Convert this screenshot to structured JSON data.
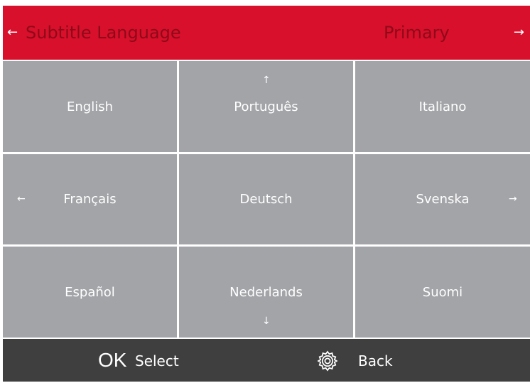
{
  "header": {
    "title": "Subtitle Language",
    "mode": "Primary",
    "left_arrow": "←",
    "right_arrow": "→"
  },
  "grid": {
    "items": [
      {
        "label": "English"
      },
      {
        "label": "Português"
      },
      {
        "label": "Italiano"
      },
      {
        "label": "Français"
      },
      {
        "label": "Deutsch"
      },
      {
        "label": "Svenska"
      },
      {
        "label": "Español"
      },
      {
        "label": "Nederlands"
      },
      {
        "label": "Suomi"
      }
    ],
    "nav": {
      "up": "↑",
      "down": "↓",
      "left": "←",
      "right": "→"
    }
  },
  "footer": {
    "ok_glyph": "OK",
    "select_label": "Select",
    "back_label": "Back"
  },
  "icons": {
    "back": "gear-icon"
  },
  "colors": {
    "header_bg": "#d8102c",
    "header_text": "#8e0a18",
    "cell_bg": "#a2a4a7",
    "footer_bg": "#3f3f3f"
  }
}
